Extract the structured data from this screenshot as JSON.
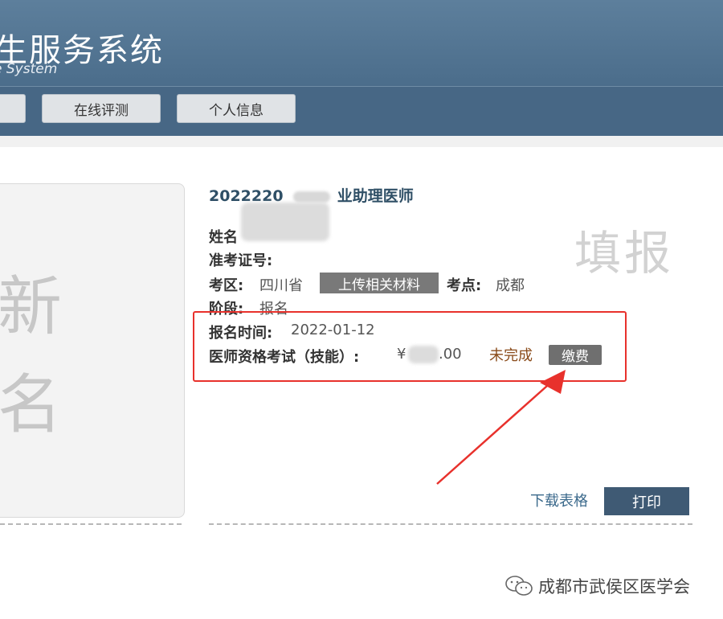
{
  "header": {
    "title": "生服务系统",
    "subtitle": "e System"
  },
  "nav": {
    "items": [
      {
        "label": ""
      },
      {
        "label": "在线评测"
      },
      {
        "label": "个人信息"
      }
    ]
  },
  "photo_placeholder": {
    "chars": [
      "新",
      "名"
    ]
  },
  "exam": {
    "title_prefix": "2022220",
    "title_suffix": "业助理医师"
  },
  "fields": {
    "name_label": "姓名",
    "admission_label": "准考证号:",
    "region_label": "考区:",
    "region_value": "四川省",
    "upload_button": "上传相关材料",
    "site_label": "考点:",
    "site_value": "成都",
    "stage_label": "阶段:",
    "stage_value": "报名"
  },
  "stamp_text": "填报",
  "registration": {
    "time_label": "报名时间:",
    "time_value": "2022-01-12",
    "fee_label": "医师资格考试（技能）:",
    "fee_currency": "¥",
    "fee_value_tail": ".00",
    "status": "未完成",
    "pay_button": "缴费"
  },
  "actions": {
    "download_label": "下载表格",
    "print_label": "打印"
  },
  "watermark": {
    "text": "成都市武侯区医学会"
  }
}
